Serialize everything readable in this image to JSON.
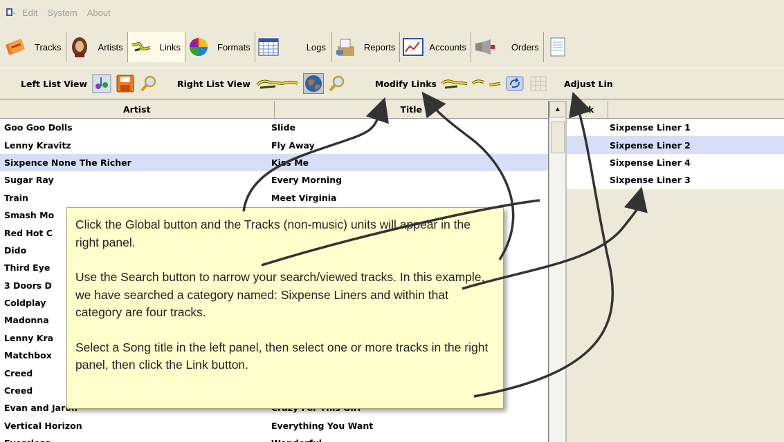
{
  "menu": {
    "items": [
      "Edit",
      "System",
      "About"
    ]
  },
  "toolbar": {
    "buttons": [
      {
        "label": "Tracks",
        "icon": "tracks-icon"
      },
      {
        "label": "Artists",
        "icon": "artist-icon"
      },
      {
        "label": "Links",
        "icon": "links-icon"
      },
      {
        "label": "Formats",
        "icon": "formats-icon"
      },
      {
        "label": "Logs",
        "icon": "logs-icon"
      },
      {
        "label": "Reports",
        "icon": "reports-icon"
      },
      {
        "label": "Accounts",
        "icon": "accounts-icon"
      },
      {
        "label": "Orders",
        "icon": "orders-icon"
      }
    ]
  },
  "subtoolbar": {
    "left_list_view": "Left List View",
    "right_list_view": "Right List View",
    "modify_links": "Modify Links",
    "adjust_links": "Adjust Lin"
  },
  "left_list": {
    "headers": [
      "Artist",
      "Title"
    ],
    "rows": [
      {
        "artist": "Goo Goo Dolls",
        "title": "Slide"
      },
      {
        "artist": "Lenny Kravitz",
        "title": "Fly Away"
      },
      {
        "artist": "Sixpence None The Richer",
        "title": "Kiss Me"
      },
      {
        "artist": "Sugar Ray",
        "title": "Every Morning"
      },
      {
        "artist": "Train",
        "title": "Meet Virginia"
      },
      {
        "artist": "Smash Mo",
        "title": ""
      },
      {
        "artist": "Red Hot C",
        "title": ""
      },
      {
        "artist": "Dido",
        "title": ""
      },
      {
        "artist": "Third Eye",
        "title": ""
      },
      {
        "artist": "3 Doors D",
        "title": ""
      },
      {
        "artist": "Coldplay",
        "title": ""
      },
      {
        "artist": "Madonna",
        "title": ""
      },
      {
        "artist": "Lenny Kra",
        "title": ""
      },
      {
        "artist": "Matchbox",
        "title": ""
      },
      {
        "artist": "Creed",
        "title": ""
      },
      {
        "artist": "Creed",
        "title": ""
      },
      {
        "artist": "Evan and Jaron",
        "title": "Crazy For This Girl"
      },
      {
        "artist": "Vertical Horizon",
        "title": "Everything You Want"
      },
      {
        "artist": "Everclear",
        "title": "Wonderful"
      }
    ]
  },
  "right_list": {
    "header": "Link",
    "rows": [
      "Sixpense Liner 1",
      "Sixpense Liner 2",
      "Sixpense Liner 4",
      "Sixpense Liner 3"
    ]
  },
  "tooltip": {
    "p1": "Click the Global button and the Tracks (non-music) units will appear in the right panel.",
    "p2": "Use the Search button to narrow your search/viewed tracks.  In this example, we have searched a category named: Sixpense Liners and within that category are four tracks.",
    "p3": "Select a Song title in the left panel, then select one or more tracks in the right panel, then click the Link button."
  }
}
